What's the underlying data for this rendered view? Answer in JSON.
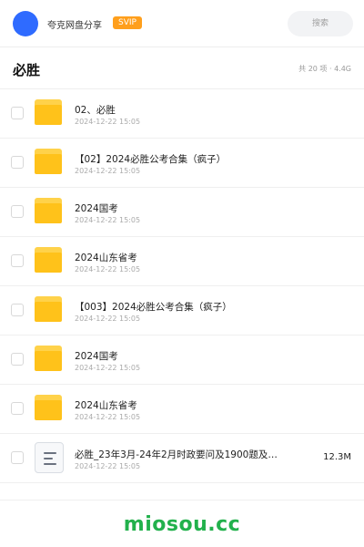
{
  "header": {
    "share_name": "夸克网盘分享",
    "badge": "SVIP",
    "search_placeholder": "搜索"
  },
  "folder": {
    "title": "必胜",
    "summary": "共 20 项 · 4.4G"
  },
  "items": [
    {
      "type": "folder",
      "name": "02、必胜",
      "date": "2024-12-22 15:05",
      "size": ""
    },
    {
      "type": "folder",
      "name": "【02】2024必胜公考合集（疯子）",
      "date": "2024-12-22 15:05",
      "size": ""
    },
    {
      "type": "folder",
      "name": "2024国考",
      "date": "2024-12-22 15:05",
      "size": ""
    },
    {
      "type": "folder",
      "name": "2024山东省考",
      "date": "2024-12-22 15:05",
      "size": ""
    },
    {
      "type": "folder",
      "name": "【003】2024必胜公考合集（疯子）",
      "date": "2024-12-22 15:05",
      "size": ""
    },
    {
      "type": "folder",
      "name": "2024国考",
      "date": "2024-12-22 15:05",
      "size": ""
    },
    {
      "type": "folder",
      "name": "2024山东省考",
      "date": "2024-12-22 15:05",
      "size": ""
    },
    {
      "type": "file",
      "name": "必胜_23年3月-24年2月时政要问及1900题及…",
      "date": "2024-12-22 15:05",
      "size": "12.3M"
    }
  ],
  "footer": {
    "watermark": "miosou.cc"
  },
  "colors": {
    "avatar": "#2f6bff",
    "badge": "#ff9f1c",
    "folder": "#ffc21a",
    "watermark": "#22b14c"
  }
}
